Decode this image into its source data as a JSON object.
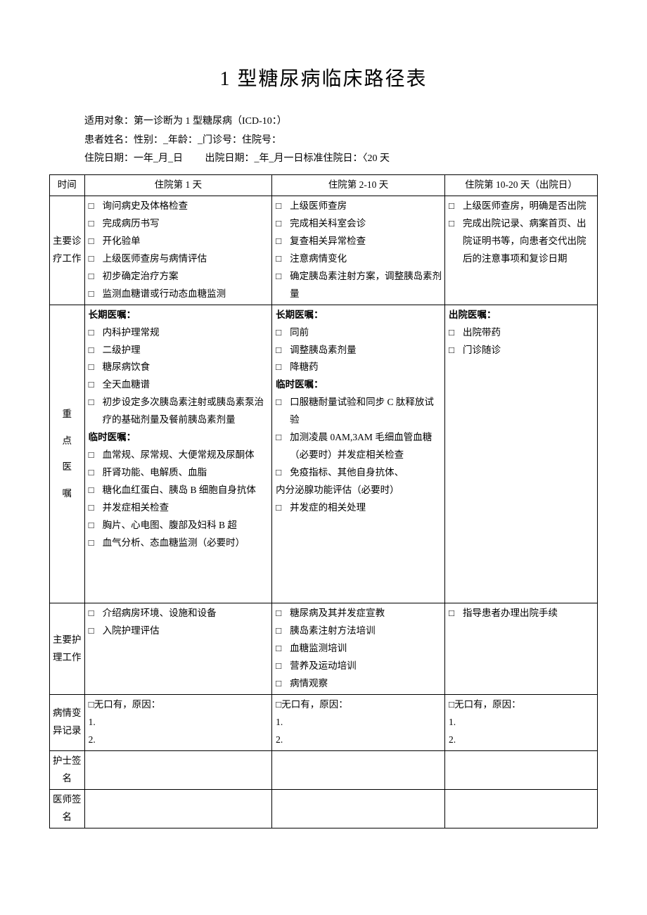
{
  "title": "1 型糖尿病临床路径表",
  "intro": {
    "line1": "适用对象：第一诊断为 1 型糖尿病（ICD-10：）",
    "line2": "患者姓名：性别：_年龄：_门诊号：住院号：",
    "line3_a": "住院日期：一年_月_日",
    "line3_b": "出院日期：_年_月一日标准住院日：〈20 天"
  },
  "headers": {
    "time": "时间",
    "day1": "住院第 1 天",
    "day2_10": "住院第 2-10 天",
    "day10_20": "住院第 10-20 天（出院日）"
  },
  "rows": {
    "main_work": "主要诊疗工作",
    "orders": "重点医嘱",
    "nursing": "主要护理工作",
    "variance": "病情变异记录",
    "nurse_sign": "护士签名",
    "doctor_sign": "医师签名"
  },
  "sub": {
    "long_term": "长期医嘱：",
    "temp_order": "临时医嘱：",
    "temp_order2": "临时医嘱：",
    "discharge_order": "出院医嘱："
  },
  "day1": {
    "main": [
      "询问病史及体格检查",
      "完成病历书写",
      "开化验单",
      "上级医师查房与病情评估",
      "初步确定治疗方案",
      "监测血糖谱或行动态血糖监测"
    ],
    "long_term": [
      "内科护理常规",
      "二级护理",
      "糖尿病饮食",
      "全天血糖谱",
      "初步设定多次胰岛素注射或胰岛素泵治疗的基础剂量及餐前胰岛素剂量"
    ],
    "temp": [
      "血常规、尿常规、大便常规及尿酮体",
      "肝肾功能、电解质、血脂",
      "糖化血红蛋白、胰岛 B 细胞自身抗体",
      "并发症相关检查",
      "胸片、心电图、腹部及妇科 B 超",
      "血气分析、态血糖监测（必要时）"
    ],
    "nursing": [
      "介绍病房环境、设施和设备",
      "入院护理评估"
    ]
  },
  "day2_10": {
    "main": [
      "上级医师查房",
      "完成相关科室会诊",
      "复查相关异常检查",
      "注意病情变化",
      "确定胰岛素注射方案，调整胰岛素剂量"
    ],
    "long_term": [
      "同前",
      "调整胰岛素剂量",
      "降糖药"
    ],
    "temp": [
      "口服糖耐量试验和同步 C 肽释放试验",
      "加测凌晨 0AM,3AM 毛细血管血糖（必要时）并发症相关检查",
      "免疫指标、其他自身抗体、"
    ],
    "temp_extra": "内分泌腺功能评估（必要时）",
    "temp_after": [
      "并发症的相关处理"
    ],
    "nursing": [
      "糖尿病及其并发症宣教",
      "胰岛素注射方法培训",
      "血糖监测培训",
      "营养及运动培训",
      "病情观察"
    ]
  },
  "day10_20": {
    "main": [
      "上级医师查房，明确是否出院",
      "完成出院记录、病案首页、出院证明书等，向患者交代出院后的注意事项和复诊日期"
    ],
    "discharge": [
      "出院带药",
      "门诊随诊"
    ],
    "nursing": [
      "指导患者办理出院手续"
    ]
  },
  "variance": {
    "prefix": "无口有，原因："
  }
}
